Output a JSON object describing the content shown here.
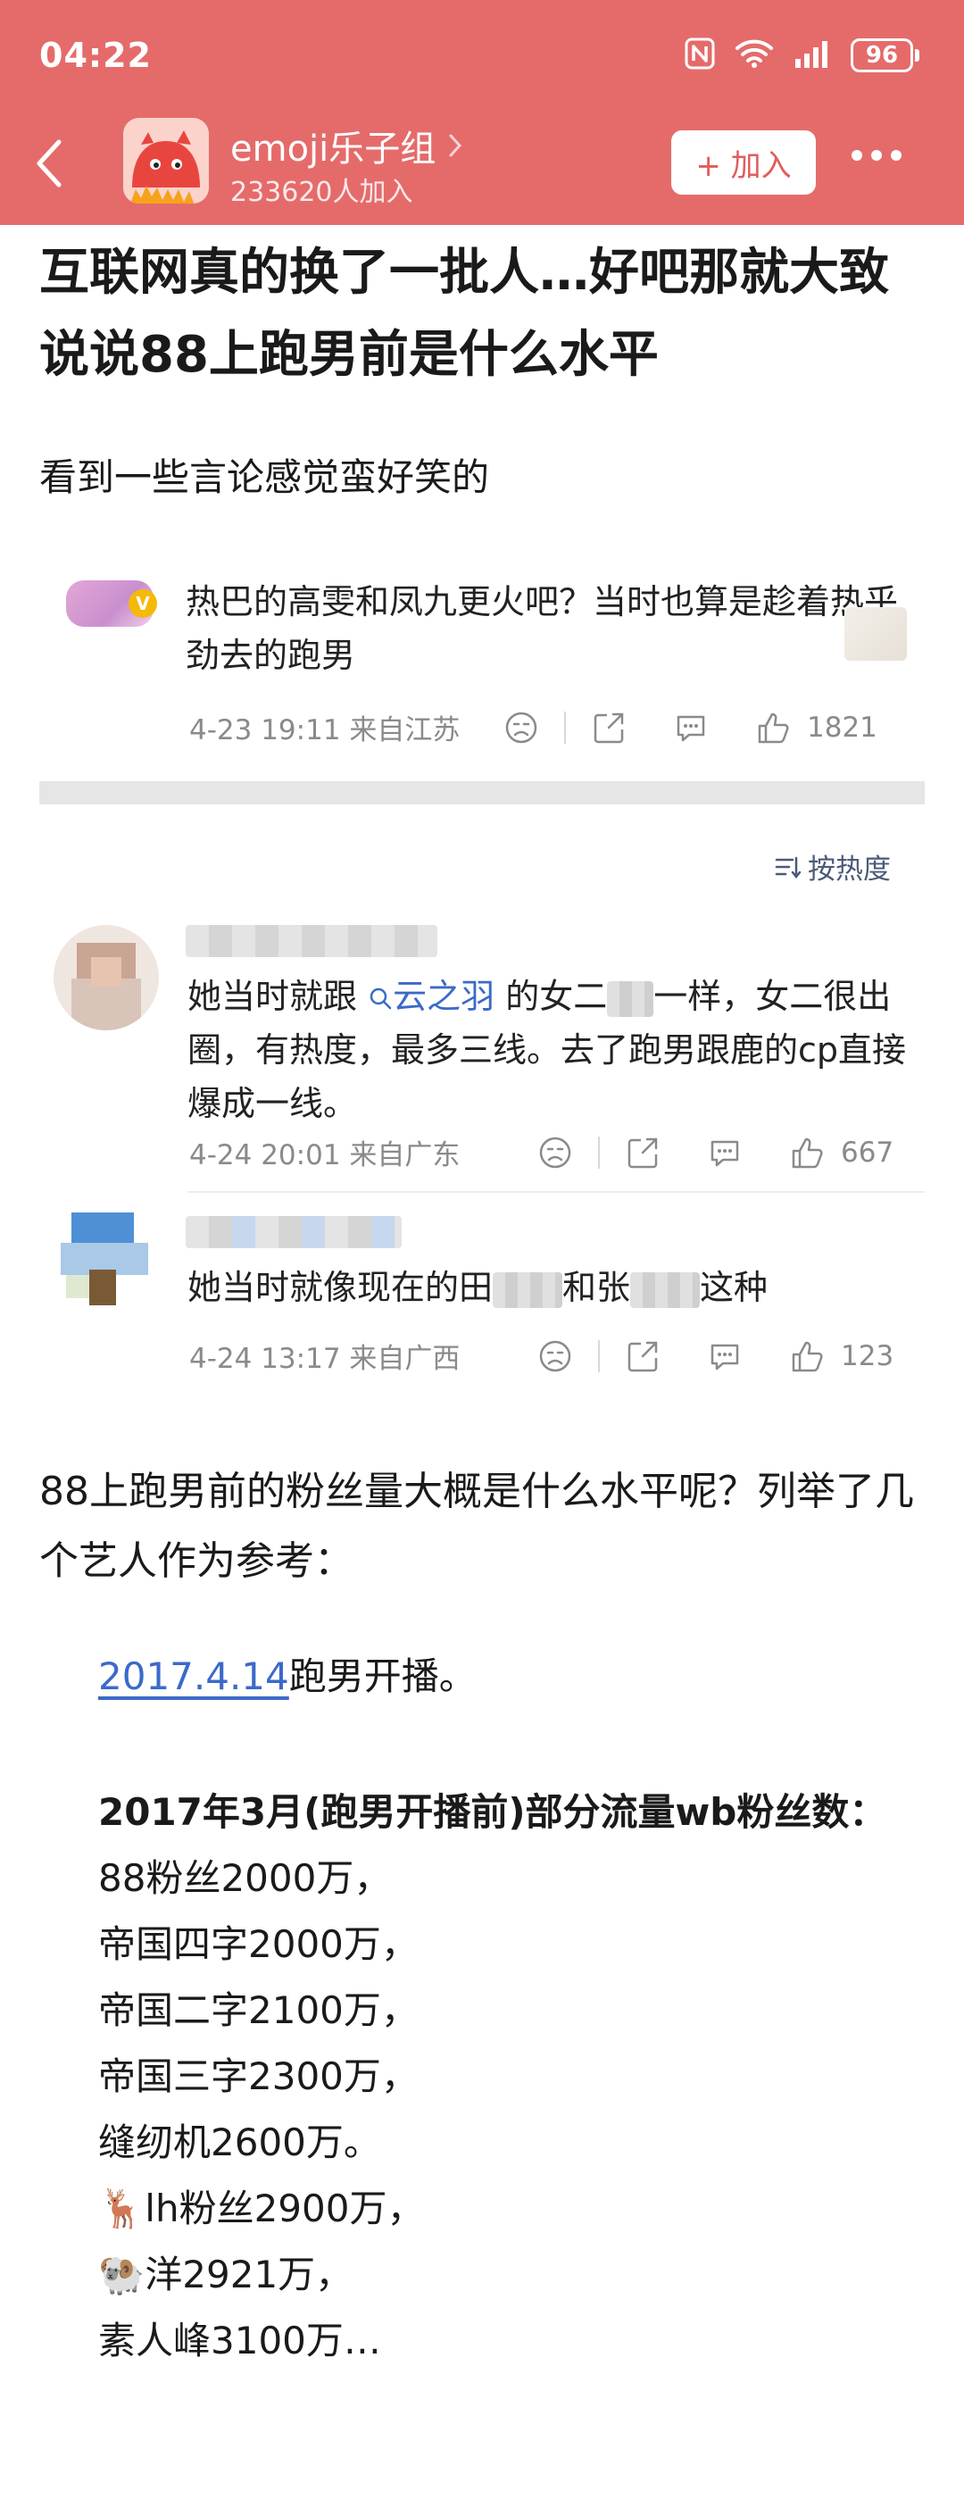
{
  "status_bar": {
    "time": "04:22",
    "battery": "96",
    "icons": [
      "nfc-icon",
      "wifi-icon",
      "signal-icon",
      "battery-icon"
    ]
  },
  "header": {
    "group_name": "emoji乐子组",
    "member_count": "233620人加入",
    "join_label": "+ 加入"
  },
  "post": {
    "title": "互联网真的换了一批人…好吧那就大致说说88上跑男前是什么水平",
    "intro": "看到一些言论感觉蛮好笑的"
  },
  "quoted_comment": {
    "text": "热巴的高雯和凤九更火吧？当时也算是趁着热乎劲去的跑男",
    "time_location": "4-23 19:11  来自江苏",
    "likes": "1821"
  },
  "sort_label": "按热度",
  "comments": [
    {
      "text_prefix": "她当时就跟",
      "mention": "云之羽",
      "text_mid": " 的女二",
      "text_suffix": "一样，女二很出圈，有热度，最多三线。去了跑男跟鹿的cp直接爆成一线。",
      "time_location": "4-24 20:01  来自广东",
      "likes": "667"
    },
    {
      "text_prefix": "她当时就像现在的田",
      "text_mid": "和张",
      "text_suffix": "这种",
      "time_location": "4-24 13:17  来自广西",
      "likes": "123"
    }
  ],
  "body": {
    "question": "88上跑男前的粉丝量大概是什么水平呢？列举了几个艺人作为参考：",
    "date_link": "2017.4.14",
    "date_suffix": "跑男开播。",
    "list_heading": "2017年3月(跑男开播前)部分流量wb粉丝数：",
    "lines": [
      "88粉丝2000万，",
      "帝国四字2000万，",
      "帝国二字2100万，",
      "帝国三字2300万，",
      "缝纫机2600万。",
      "🦌lh粉丝2900万，",
      "🐏洋2921万，",
      "素人峰3100万…"
    ]
  },
  "colors": {
    "header_bg": "#e56b6b",
    "join_text": "#e25c5c",
    "link": "#3b6ac8",
    "meta_gray": "#8a8a8a"
  }
}
